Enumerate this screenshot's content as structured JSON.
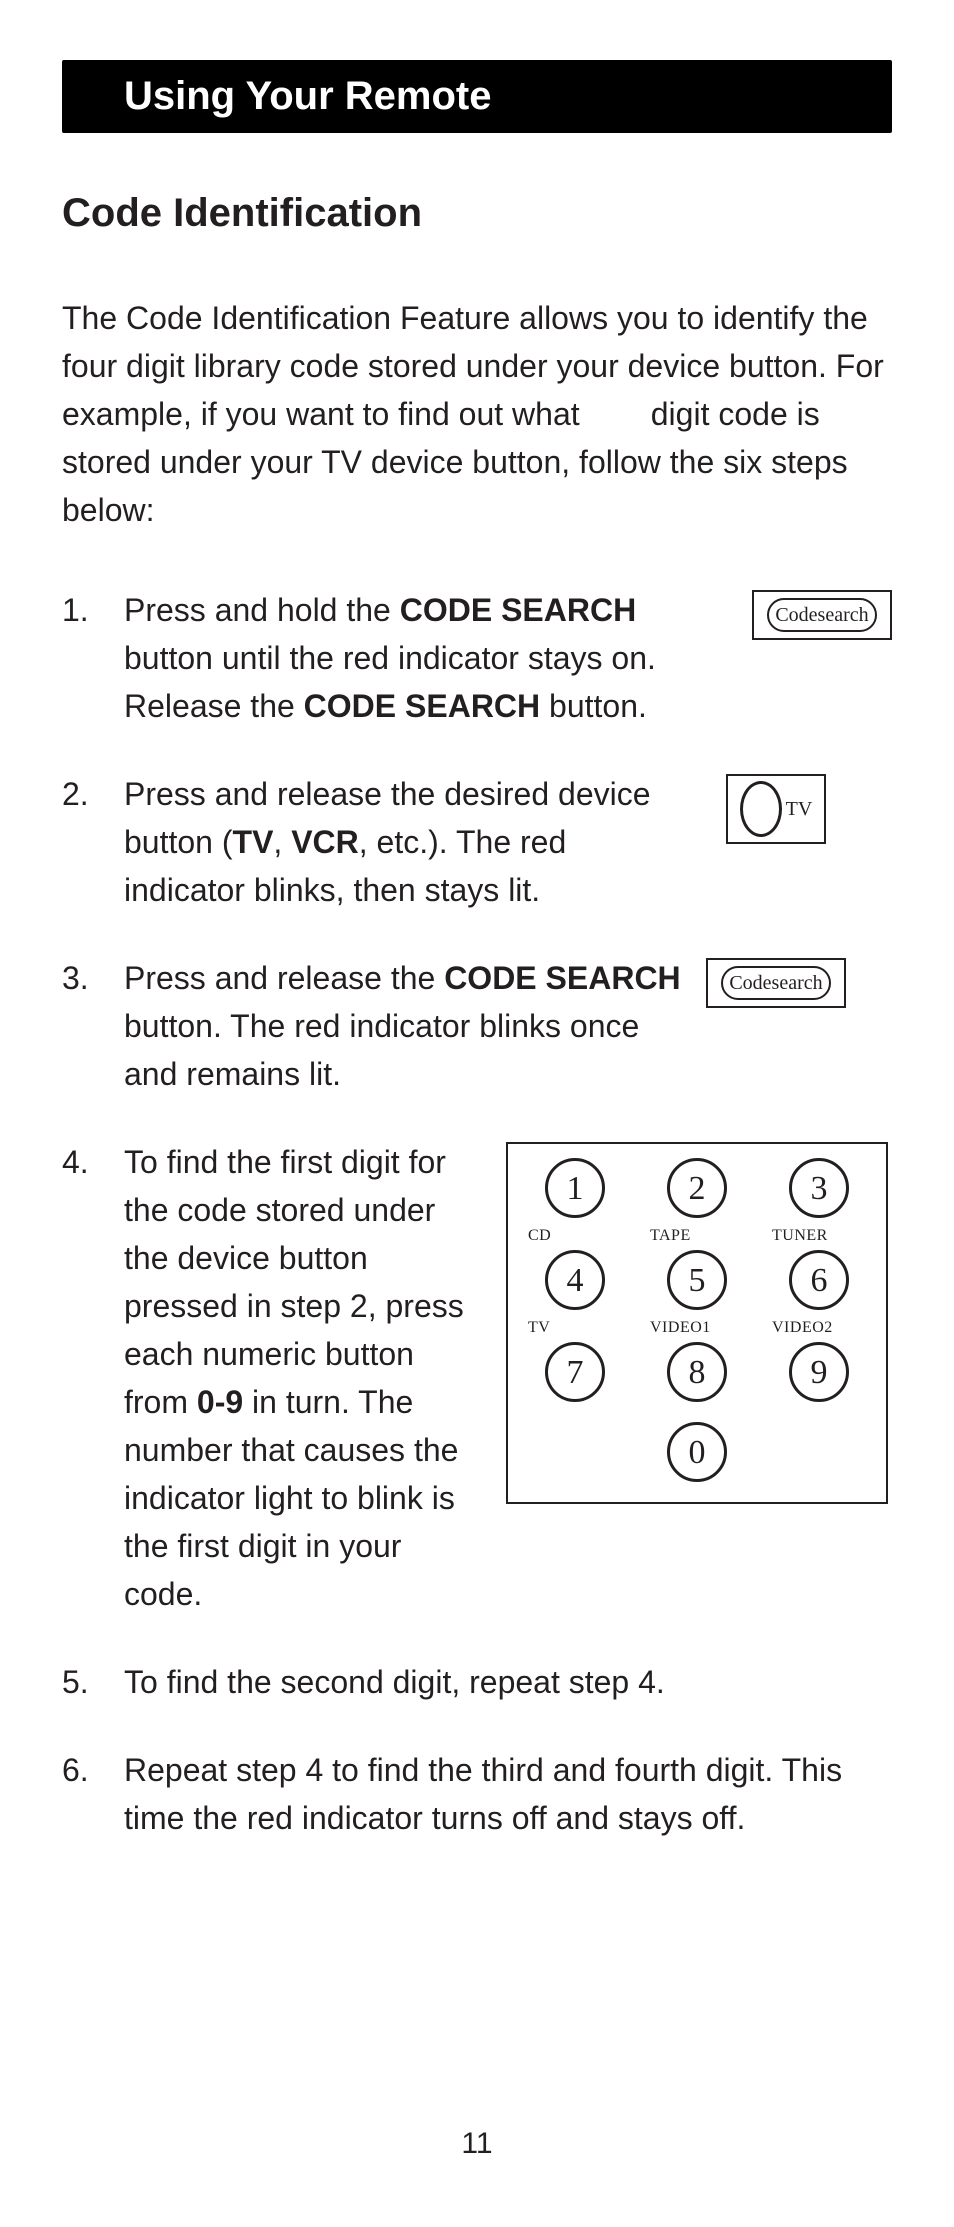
{
  "header": "Using Your Remote",
  "section_title": "Code Identification",
  "intro_parts": {
    "p1": "The Code Identification Feature allows you to identify the four digit library code stored under your device button. For example, if you want to find out what",
    "spacer": "        ",
    "p2": "digit code is stored under your TV device button, follow the six steps below:"
  },
  "steps": {
    "s1": {
      "a": "Press and hold the ",
      "b": "CODE SEARCH",
      "c": " button until the red indicator stays on. Release the ",
      "d": "CODE SEARCH",
      "e": " button."
    },
    "s2": {
      "a": "Press and release the desired device button (",
      "b": "TV",
      "c": ", ",
      "d": "VCR",
      "e": ", etc.). The red indicator blinks, then stays lit."
    },
    "s3": {
      "a": "Press and release the ",
      "b": "CODE SEARCH",
      "c": " button. The red indicator blinks once and remains lit."
    },
    "s4": {
      "a": "To find the first digit for the code stored under the device button pressed in step 2, press each numeric button from ",
      "b": "0-9",
      "c": " in turn. The number that causes the indicator light to blink is the first digit in your code."
    },
    "s5": "To find the second digit, repeat step 4.",
    "s6": "Repeat step 4 to find the third and fourth digit. This time the red indicator turns off and  stays off."
  },
  "codesearch_label": "Codesearch",
  "tv_label": "TV",
  "keypad": {
    "keys": [
      "1",
      "2",
      "3",
      "4",
      "5",
      "6",
      "7",
      "8",
      "9",
      "0"
    ],
    "labels": [
      "CD",
      "TAPE",
      "TUNER",
      "TV",
      "VIDEO1",
      "VIDEO2"
    ]
  },
  "page_number": "11"
}
